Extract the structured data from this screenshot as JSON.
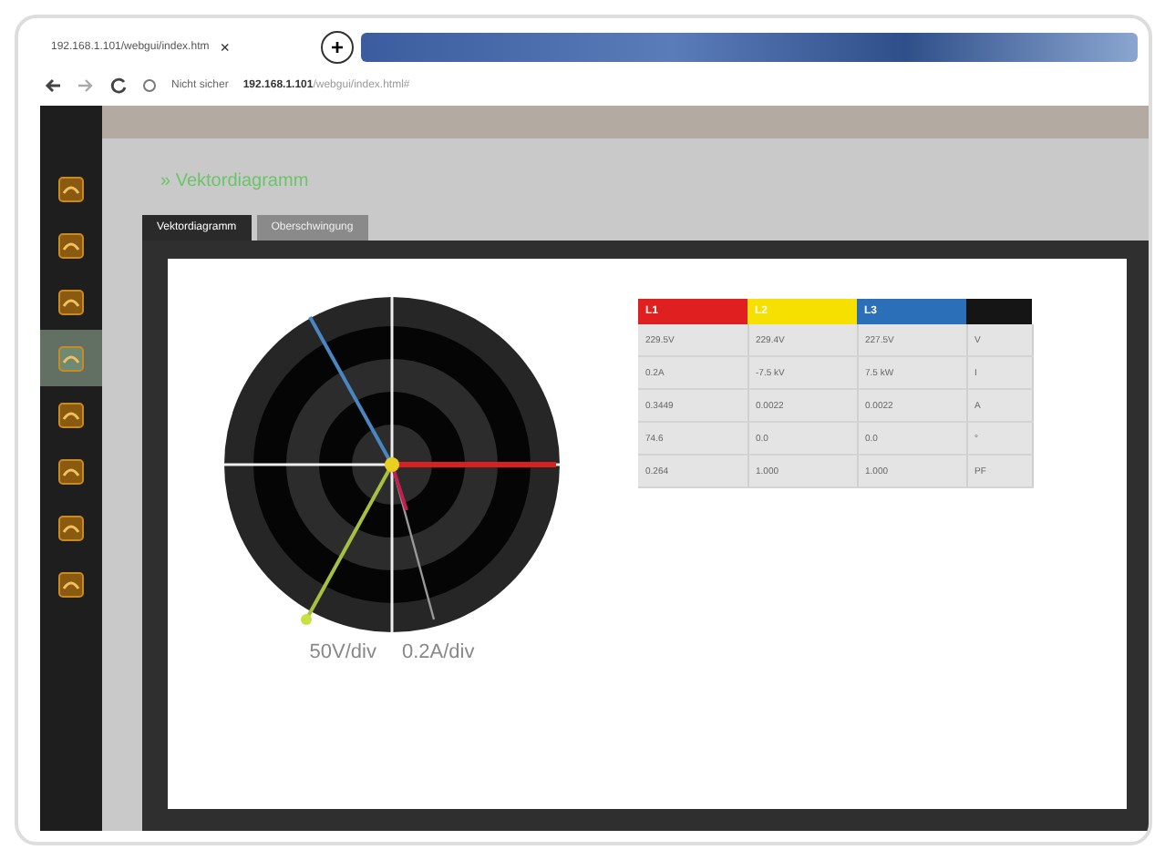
{
  "browser": {
    "tab_title": "192.168.1.101/webgui/index.htm",
    "tab_close": "×",
    "new_tab": "+",
    "security": "Nicht sicher",
    "url_host": "192.168.1.101",
    "url_path": "/webgui/index.html#"
  },
  "sidebar": {
    "items": [
      {
        "selected": false
      },
      {
        "selected": false
      },
      {
        "selected": false
      },
      {
        "selected": true
      },
      {
        "selected": false
      },
      {
        "selected": false
      },
      {
        "selected": false
      },
      {
        "selected": false
      }
    ]
  },
  "page": {
    "heading": "» Vektordiagramm",
    "tabs": [
      {
        "label": "Vektordiagramm",
        "selected": true
      },
      {
        "label": "Oberschwingung",
        "selected": false
      }
    ],
    "phasor": {
      "voltage_scale": "50V/div",
      "current_scale": "0.2A/div"
    },
    "table": {
      "columns": [
        {
          "label": "L1",
          "color": "#e02020"
        },
        {
          "label": "L2",
          "color": "#f5e000"
        },
        {
          "label": "L3",
          "color": "#2a6fb8"
        },
        {
          "color": "#151515"
        }
      ],
      "rows": [
        [
          "229.5V",
          "229.4V",
          "227.5V",
          "V"
        ],
        [
          "0.2A",
          "-7.5 kV",
          "7.5 kW",
          "I"
        ],
        [
          "0.3449",
          "0.0022",
          "0.0022",
          "A"
        ],
        [
          "74.6",
          "0.0",
          "0.0",
          "°"
        ],
        [
          "0.264",
          "1.000",
          "1.000",
          "PF"
        ]
      ]
    }
  }
}
